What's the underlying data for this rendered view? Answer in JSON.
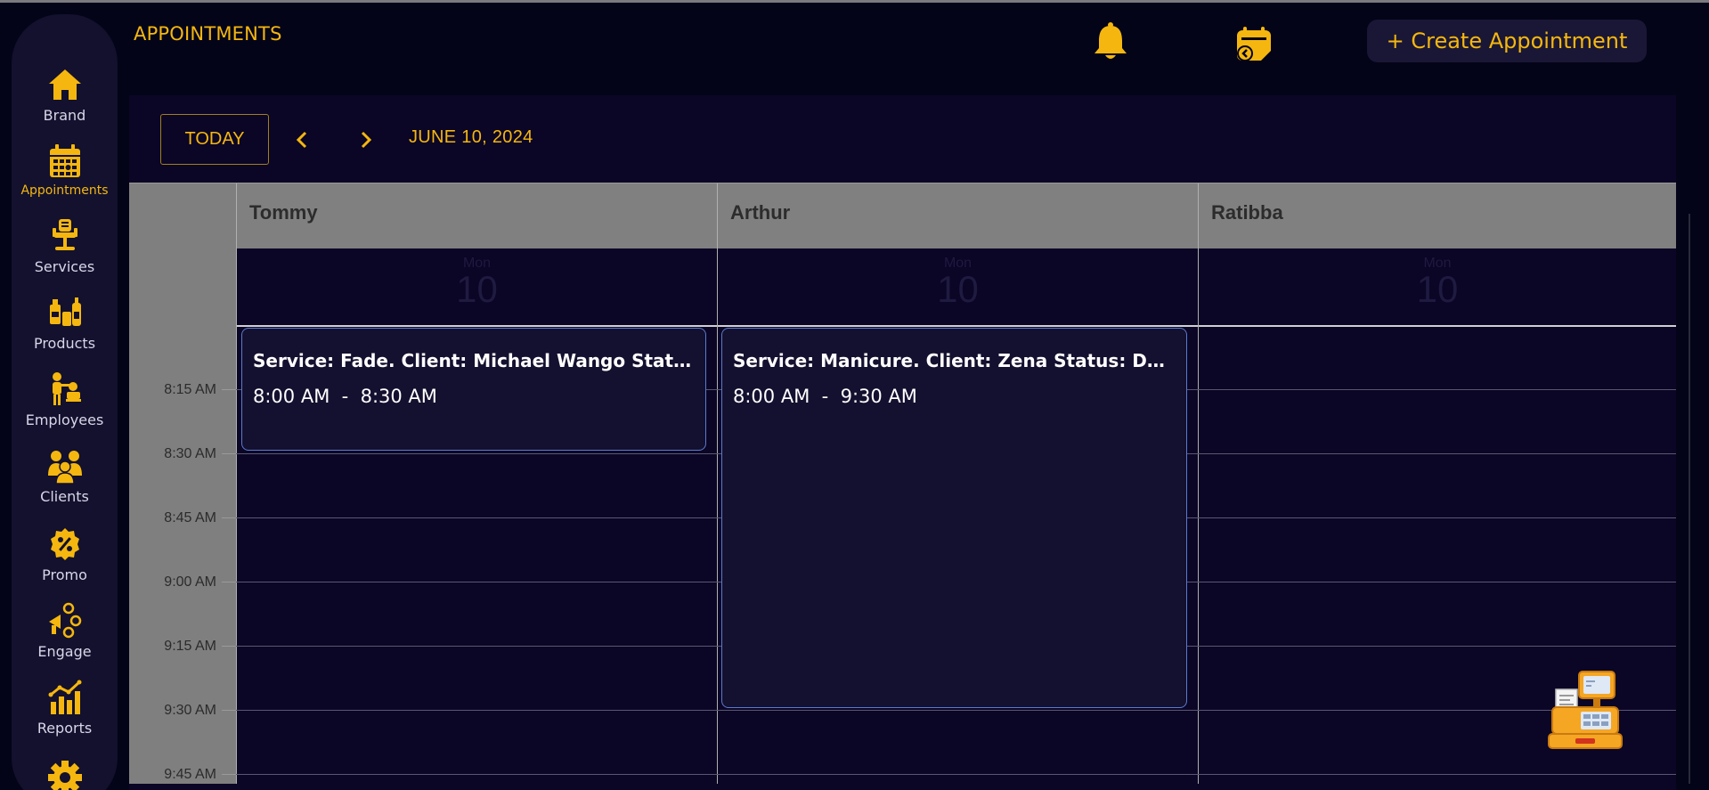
{
  "app": {
    "page_title": "APPOINTMENTS",
    "create_button": "+ Create Appointment"
  },
  "sidebar": {
    "items": [
      {
        "label": "Brand",
        "icon": "home-icon"
      },
      {
        "label": "Appointments",
        "icon": "calendar-icon",
        "active": true
      },
      {
        "label": "Services",
        "icon": "barber-chair-icon"
      },
      {
        "label": "Products",
        "icon": "products-icon"
      },
      {
        "label": "Employees",
        "icon": "employee-icon"
      },
      {
        "label": "Clients",
        "icon": "clients-icon"
      },
      {
        "label": "Promo",
        "icon": "promo-icon"
      },
      {
        "label": "Engage",
        "icon": "engage-icon"
      },
      {
        "label": "Reports",
        "icon": "reports-icon"
      },
      {
        "label": "",
        "icon": "settings-icon"
      }
    ]
  },
  "toolbar": {
    "today": "TODAY",
    "date": "JUNE 10, 2024"
  },
  "calendar": {
    "resources": [
      {
        "name": "Tommy",
        "dow": "Mon",
        "day": "10"
      },
      {
        "name": "Arthur",
        "dow": "Mon",
        "day": "10"
      },
      {
        "name": "Ratibba",
        "dow": "Mon",
        "day": "10"
      }
    ],
    "times": [
      "8:15 AM",
      "8:30 AM",
      "8:45 AM",
      "9:00 AM",
      "9:15 AM",
      "9:30 AM",
      "9:45 AM"
    ],
    "events": [
      {
        "title": "Service: Fade. Client: Michael Wango Status: Done",
        "time": "8:00 AM  -  8:30 AM"
      },
      {
        "title": "Service: Manicure. Client: Zena Status: Done",
        "time": "8:00 AM  -  9:30 AM"
      }
    ]
  },
  "colors": {
    "accent": "#f5b70f",
    "background": "#040419",
    "sidebar": "#13112e",
    "event_border": "#5a7bd0"
  }
}
